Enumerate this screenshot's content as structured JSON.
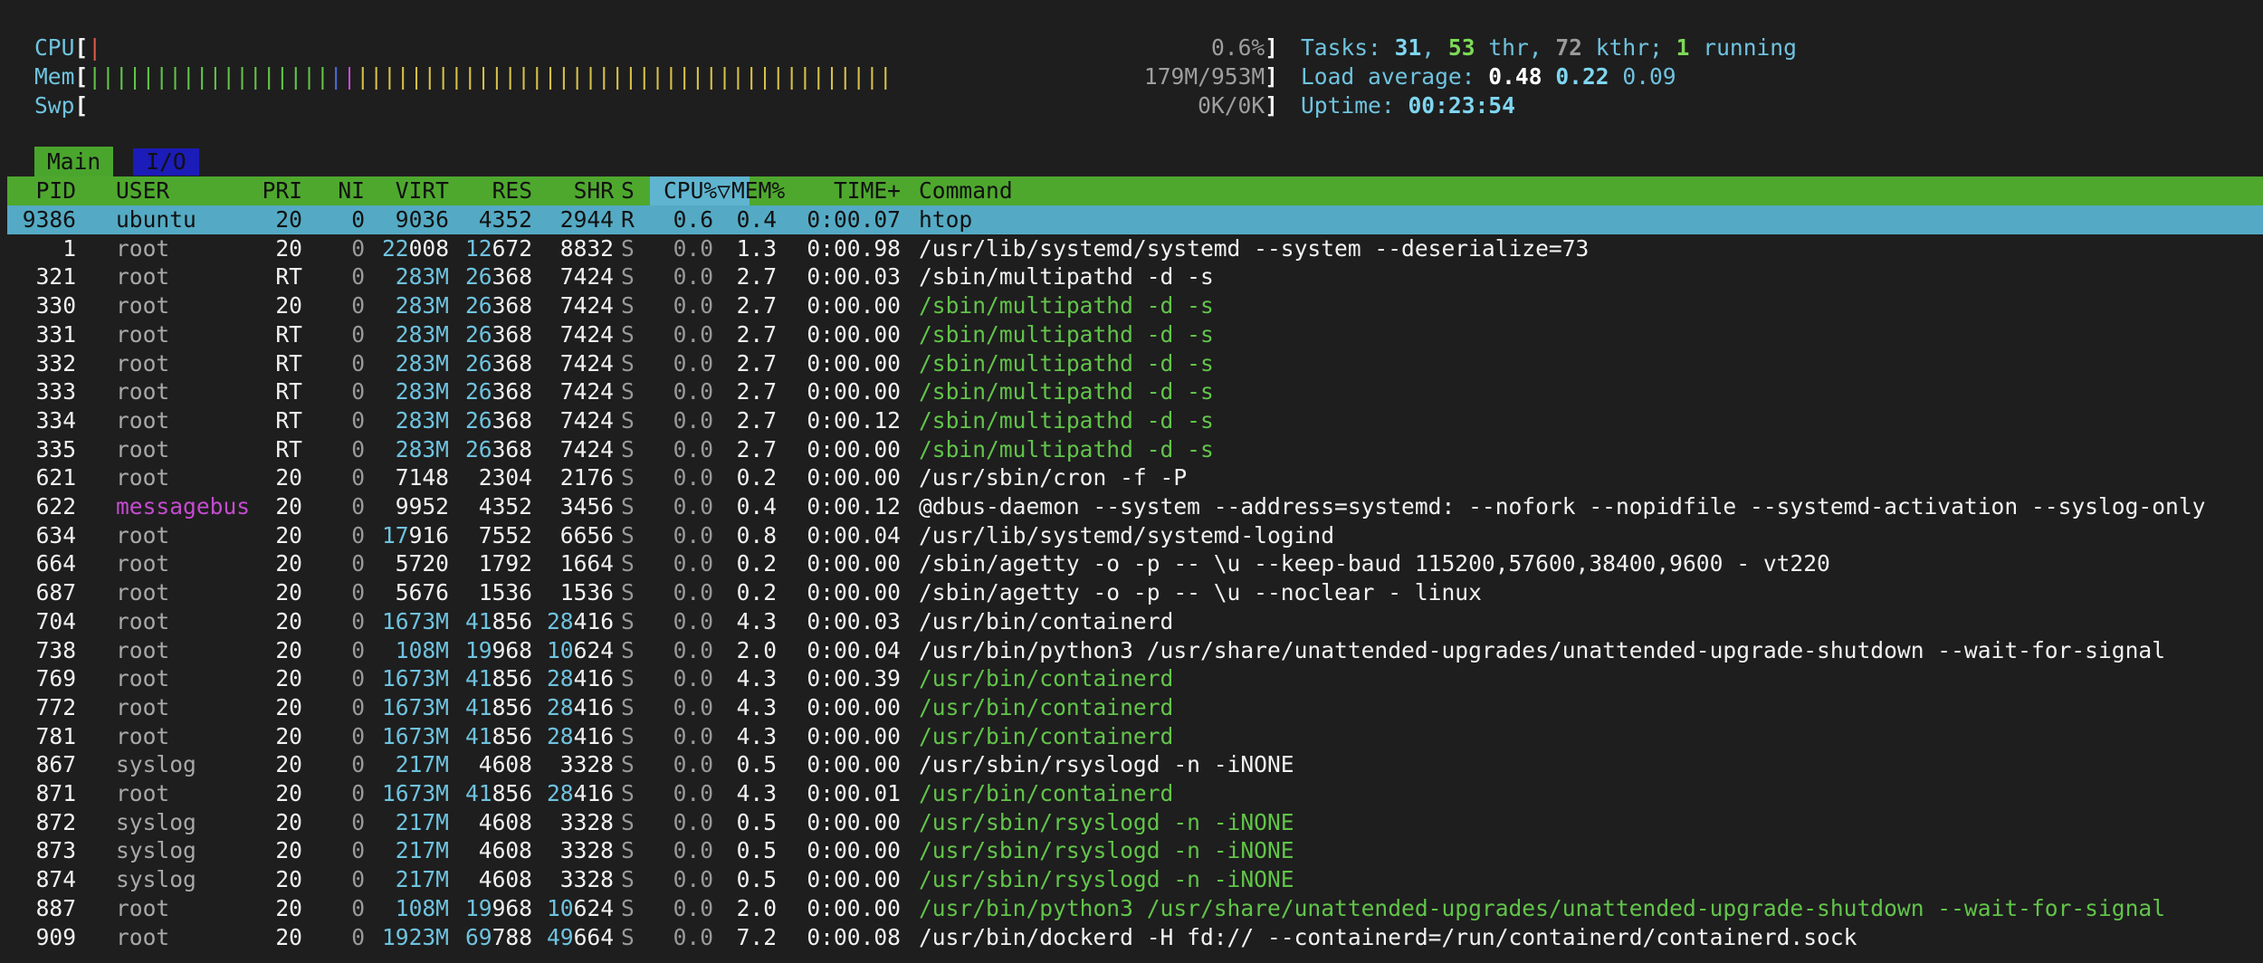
{
  "meters": {
    "cpu": {
      "label": "CPU",
      "bar": "|",
      "value": "0.6%"
    },
    "mem": {
      "label": "Mem",
      "bar_green": "||||||||||||||||||",
      "bar_blue": "|",
      "bar_magenta": "|",
      "bar_yellow": "||||||||||||||||||||||||||||||||||||||||",
      "value": "179M/953M"
    },
    "swp": {
      "label": "Swp",
      "value": "0K/0K"
    }
  },
  "info": {
    "tasks_label": "Tasks: ",
    "tasks": "31",
    "sep1": ", ",
    "threads": "53",
    "thr_label": " thr, ",
    "kthreads": "72",
    "kthr_label": " kthr; ",
    "running": "1",
    "running_label": " running",
    "load_label": "Load average: ",
    "load1": "0.48",
    "load5": "0.22",
    "load15": "0.09",
    "uptime_label": "Uptime: ",
    "uptime": "00:23:54"
  },
  "tabs": {
    "main": "Main",
    "io": "I/O"
  },
  "columns": {
    "pid": "PID",
    "user": "USER",
    "pri": "PRI",
    "ni": "NI",
    "virt": "VIRT",
    "res": "RES",
    "shr": "SHR",
    "s": "S",
    "cpu": "CPU%▽",
    "mem": "MEM%",
    "time": "TIME+",
    "command": "Command"
  },
  "colors": {
    "header_bg": "#4ea82e",
    "selected_bg": "#54aac4",
    "sorted_col_bg": "#5fb4cf",
    "background": "#1e1e1e"
  },
  "processes": [
    {
      "pid": "9386",
      "user": "ubuntu",
      "pri": "20",
      "ni": "0",
      "virt": "9036",
      "res": "4352",
      "shr": "2944",
      "s": "R",
      "cpu": "0.6",
      "mem": "0.4",
      "time": "0:00.07",
      "cmd": "htop",
      "thread": false,
      "selected": true
    },
    {
      "pid": "1",
      "user": "root",
      "pri": "20",
      "ni": "0",
      "virt": "22008",
      "res": "12672",
      "shr": "8832",
      "s": "S",
      "cpu": "0.0",
      "mem": "1.3",
      "time": "0:00.98",
      "cmd": "/usr/lib/systemd/systemd --system --deserialize=73",
      "thread": false
    },
    {
      "pid": "321",
      "user": "root",
      "pri": "RT",
      "ni": "0",
      "virt": "283M",
      "res": "26368",
      "shr": "7424",
      "s": "S",
      "cpu": "0.0",
      "mem": "2.7",
      "time": "0:00.03",
      "cmd": "/sbin/multipathd -d -s",
      "thread": false
    },
    {
      "pid": "330",
      "user": "root",
      "pri": "20",
      "ni": "0",
      "virt": "283M",
      "res": "26368",
      "shr": "7424",
      "s": "S",
      "cpu": "0.0",
      "mem": "2.7",
      "time": "0:00.00",
      "cmd": "/sbin/multipathd -d -s",
      "thread": true
    },
    {
      "pid": "331",
      "user": "root",
      "pri": "RT",
      "ni": "0",
      "virt": "283M",
      "res": "26368",
      "shr": "7424",
      "s": "S",
      "cpu": "0.0",
      "mem": "2.7",
      "time": "0:00.00",
      "cmd": "/sbin/multipathd -d -s",
      "thread": true
    },
    {
      "pid": "332",
      "user": "root",
      "pri": "RT",
      "ni": "0",
      "virt": "283M",
      "res": "26368",
      "shr": "7424",
      "s": "S",
      "cpu": "0.0",
      "mem": "2.7",
      "time": "0:00.00",
      "cmd": "/sbin/multipathd -d -s",
      "thread": true
    },
    {
      "pid": "333",
      "user": "root",
      "pri": "RT",
      "ni": "0",
      "virt": "283M",
      "res": "26368",
      "shr": "7424",
      "s": "S",
      "cpu": "0.0",
      "mem": "2.7",
      "time": "0:00.00",
      "cmd": "/sbin/multipathd -d -s",
      "thread": true
    },
    {
      "pid": "334",
      "user": "root",
      "pri": "RT",
      "ni": "0",
      "virt": "283M",
      "res": "26368",
      "shr": "7424",
      "s": "S",
      "cpu": "0.0",
      "mem": "2.7",
      "time": "0:00.12",
      "cmd": "/sbin/multipathd -d -s",
      "thread": true
    },
    {
      "pid": "335",
      "user": "root",
      "pri": "RT",
      "ni": "0",
      "virt": "283M",
      "res": "26368",
      "shr": "7424",
      "s": "S",
      "cpu": "0.0",
      "mem": "2.7",
      "time": "0:00.00",
      "cmd": "/sbin/multipathd -d -s",
      "thread": true
    },
    {
      "pid": "621",
      "user": "root",
      "pri": "20",
      "ni": "0",
      "virt": "7148",
      "res": "2304",
      "shr": "2176",
      "s": "S",
      "cpu": "0.0",
      "mem": "0.2",
      "time": "0:00.00",
      "cmd": "/usr/sbin/cron -f -P",
      "thread": false
    },
    {
      "pid": "622",
      "user": "messagebus",
      "pri": "20",
      "ni": "0",
      "virt": "9952",
      "res": "4352",
      "shr": "3456",
      "s": "S",
      "cpu": "0.0",
      "mem": "0.4",
      "time": "0:00.12",
      "cmd": "@dbus-daemon --system --address=systemd: --nofork --nopidfile --systemd-activation --syslog-only",
      "thread": false
    },
    {
      "pid": "634",
      "user": "root",
      "pri": "20",
      "ni": "0",
      "virt": "17916",
      "res": "7552",
      "shr": "6656",
      "s": "S",
      "cpu": "0.0",
      "mem": "0.8",
      "time": "0:00.04",
      "cmd": "/usr/lib/systemd/systemd-logind",
      "thread": false
    },
    {
      "pid": "664",
      "user": "root",
      "pri": "20",
      "ni": "0",
      "virt": "5720",
      "res": "1792",
      "shr": "1664",
      "s": "S",
      "cpu": "0.0",
      "mem": "0.2",
      "time": "0:00.00",
      "cmd": "/sbin/agetty -o -p -- \\u --keep-baud 115200,57600,38400,9600 - vt220",
      "thread": false
    },
    {
      "pid": "687",
      "user": "root",
      "pri": "20",
      "ni": "0",
      "virt": "5676",
      "res": "1536",
      "shr": "1536",
      "s": "S",
      "cpu": "0.0",
      "mem": "0.2",
      "time": "0:00.00",
      "cmd": "/sbin/agetty -o -p -- \\u --noclear - linux",
      "thread": false
    },
    {
      "pid": "704",
      "user": "root",
      "pri": "20",
      "ni": "0",
      "virt": "1673M",
      "res": "41856",
      "shr": "28416",
      "s": "S",
      "cpu": "0.0",
      "mem": "4.3",
      "time": "0:00.03",
      "cmd": "/usr/bin/containerd",
      "thread": false
    },
    {
      "pid": "738",
      "user": "root",
      "pri": "20",
      "ni": "0",
      "virt": "108M",
      "res": "19968",
      "shr": "10624",
      "s": "S",
      "cpu": "0.0",
      "mem": "2.0",
      "time": "0:00.04",
      "cmd": "/usr/bin/python3 /usr/share/unattended-upgrades/unattended-upgrade-shutdown --wait-for-signal",
      "thread": false
    },
    {
      "pid": "769",
      "user": "root",
      "pri": "20",
      "ni": "0",
      "virt": "1673M",
      "res": "41856",
      "shr": "28416",
      "s": "S",
      "cpu": "0.0",
      "mem": "4.3",
      "time": "0:00.39",
      "cmd": "/usr/bin/containerd",
      "thread": true
    },
    {
      "pid": "772",
      "user": "root",
      "pri": "20",
      "ni": "0",
      "virt": "1673M",
      "res": "41856",
      "shr": "28416",
      "s": "S",
      "cpu": "0.0",
      "mem": "4.3",
      "time": "0:00.00",
      "cmd": "/usr/bin/containerd",
      "thread": true
    },
    {
      "pid": "781",
      "user": "root",
      "pri": "20",
      "ni": "0",
      "virt": "1673M",
      "res": "41856",
      "shr": "28416",
      "s": "S",
      "cpu": "0.0",
      "mem": "4.3",
      "time": "0:00.00",
      "cmd": "/usr/bin/containerd",
      "thread": true
    },
    {
      "pid": "867",
      "user": "syslog",
      "pri": "20",
      "ni": "0",
      "virt": "217M",
      "res": "4608",
      "shr": "3328",
      "s": "S",
      "cpu": "0.0",
      "mem": "0.5",
      "time": "0:00.00",
      "cmd": "/usr/sbin/rsyslogd -n -iNONE",
      "thread": false
    },
    {
      "pid": "871",
      "user": "root",
      "pri": "20",
      "ni": "0",
      "virt": "1673M",
      "res": "41856",
      "shr": "28416",
      "s": "S",
      "cpu": "0.0",
      "mem": "4.3",
      "time": "0:00.01",
      "cmd": "/usr/bin/containerd",
      "thread": true
    },
    {
      "pid": "872",
      "user": "syslog",
      "pri": "20",
      "ni": "0",
      "virt": "217M",
      "res": "4608",
      "shr": "3328",
      "s": "S",
      "cpu": "0.0",
      "mem": "0.5",
      "time": "0:00.00",
      "cmd": "/usr/sbin/rsyslogd -n -iNONE",
      "thread": true
    },
    {
      "pid": "873",
      "user": "syslog",
      "pri": "20",
      "ni": "0",
      "virt": "217M",
      "res": "4608",
      "shr": "3328",
      "s": "S",
      "cpu": "0.0",
      "mem": "0.5",
      "time": "0:00.00",
      "cmd": "/usr/sbin/rsyslogd -n -iNONE",
      "thread": true
    },
    {
      "pid": "874",
      "user": "syslog",
      "pri": "20",
      "ni": "0",
      "virt": "217M",
      "res": "4608",
      "shr": "3328",
      "s": "S",
      "cpu": "0.0",
      "mem": "0.5",
      "time": "0:00.00",
      "cmd": "/usr/sbin/rsyslogd -n -iNONE",
      "thread": true
    },
    {
      "pid": "887",
      "user": "root",
      "pri": "20",
      "ni": "0",
      "virt": "108M",
      "res": "19968",
      "shr": "10624",
      "s": "S",
      "cpu": "0.0",
      "mem": "2.0",
      "time": "0:00.00",
      "cmd": "/usr/bin/python3 /usr/share/unattended-upgrades/unattended-upgrade-shutdown --wait-for-signal",
      "thread": true
    },
    {
      "pid": "909",
      "user": "root",
      "pri": "20",
      "ni": "0",
      "virt": "1923M",
      "res": "69788",
      "shr": "49664",
      "s": "S",
      "cpu": "0.0",
      "mem": "7.2",
      "time": "0:00.08",
      "cmd": "/usr/bin/dockerd -H fd:// --containerd=/run/containerd/containerd.sock",
      "thread": false
    }
  ]
}
